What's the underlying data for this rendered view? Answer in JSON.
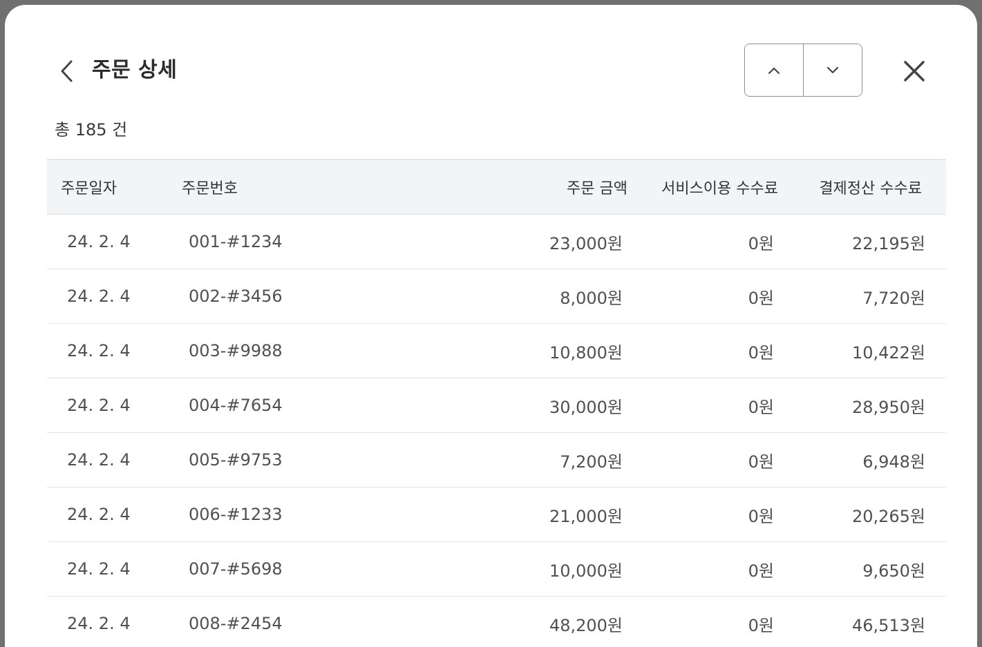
{
  "header": {
    "title": "주문 상세",
    "back_icon": "chevron-left-icon",
    "prev_icon": "chevron-up-icon",
    "next_icon": "chevron-down-icon",
    "close_icon": "close-icon"
  },
  "summary": {
    "total_label": "총 185 건"
  },
  "table": {
    "columns": [
      "주문일자",
      "주문번호",
      "주문 금액",
      "서비스이용 수수료",
      "결제정산 수수료"
    ],
    "rows": [
      {
        "date": "24. 2. 4",
        "order_no": "001-#1234",
        "amount": "23,000원",
        "service_fee": "0원",
        "settlement_fee": "22,195원"
      },
      {
        "date": "24. 2. 4",
        "order_no": "002-#3456",
        "amount": "8,000원",
        "service_fee": "0원",
        "settlement_fee": "7,720원"
      },
      {
        "date": "24. 2. 4",
        "order_no": "003-#9988",
        "amount": "10,800원",
        "service_fee": "0원",
        "settlement_fee": "10,422원"
      },
      {
        "date": "24. 2. 4",
        "order_no": "004-#7654",
        "amount": "30,000원",
        "service_fee": "0원",
        "settlement_fee": "28,950원"
      },
      {
        "date": "24. 2. 4",
        "order_no": "005-#9753",
        "amount": "7,200원",
        "service_fee": "0원",
        "settlement_fee": "6,948원"
      },
      {
        "date": "24. 2. 4",
        "order_no": "006-#1233",
        "amount": "21,000원",
        "service_fee": "0원",
        "settlement_fee": "20,265원"
      },
      {
        "date": "24. 2. 4",
        "order_no": "007-#5698",
        "amount": "10,000원",
        "service_fee": "0원",
        "settlement_fee": "9,650원"
      },
      {
        "date": "24. 2. 4",
        "order_no": "008-#2454",
        "amount": "48,200원",
        "service_fee": "0원",
        "settlement_fee": "46,513원"
      }
    ]
  }
}
